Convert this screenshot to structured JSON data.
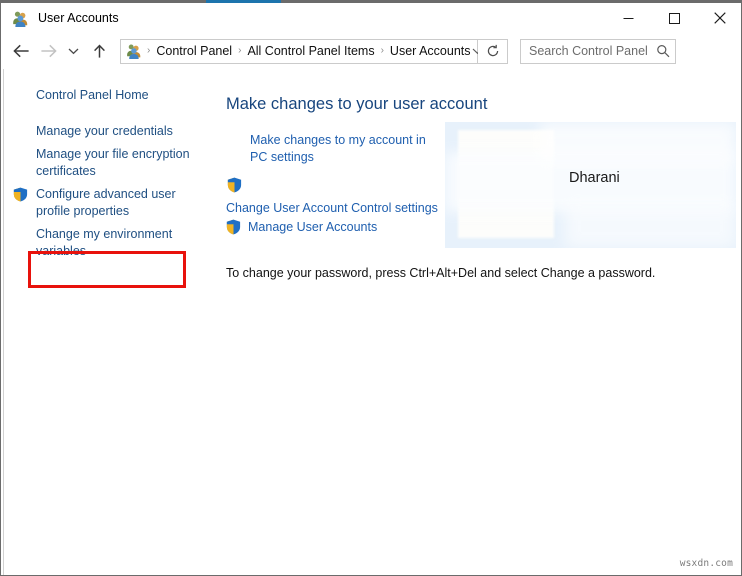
{
  "window": {
    "title": "User Accounts",
    "title_icon": "user-accounts-icon",
    "accent_color": "#1d74ad",
    "caption": {
      "minimize_label": "Minimize",
      "maximize_label": "Maximize",
      "close_label": "Close"
    }
  },
  "nav": {
    "back_label": "Back",
    "forward_label": "Forward",
    "recent_label": "Recent locations",
    "up_label": "Up one level",
    "refresh_label": "Refresh",
    "breadcrumb_dropdown_label": "Previous locations",
    "breadcrumb": [
      "Control Panel",
      "All Control Panel Items",
      "User Accounts"
    ],
    "separator": "›"
  },
  "search": {
    "placeholder": "Search Control Panel",
    "value": ""
  },
  "help": {
    "label": "?"
  },
  "sidebar": {
    "items": [
      {
        "label": "Control Panel Home",
        "shield": false
      },
      {
        "label": "Manage your credentials",
        "shield": false
      },
      {
        "label": "Manage your file encryption certificates",
        "shield": false
      },
      {
        "label": "Configure advanced user profile properties",
        "shield": true
      },
      {
        "label": "Change my environment variables",
        "shield": false
      }
    ]
  },
  "annotation": {
    "color": "#e8120c",
    "target": "Configure advanced user profile properties"
  },
  "main": {
    "heading": "Make changes to your user account",
    "pc_settings_link": "Make changes to my account in PC settings",
    "uac_link": "Change User Account Control settings",
    "manage_link": "Manage User Accounts",
    "password_note": "To change your password, press Ctrl+Alt+Del and select Change a password."
  },
  "account": {
    "username": "Dharani",
    "picture_alt": "user account picture"
  },
  "watermark": {
    "text": "wsxdn.com"
  }
}
